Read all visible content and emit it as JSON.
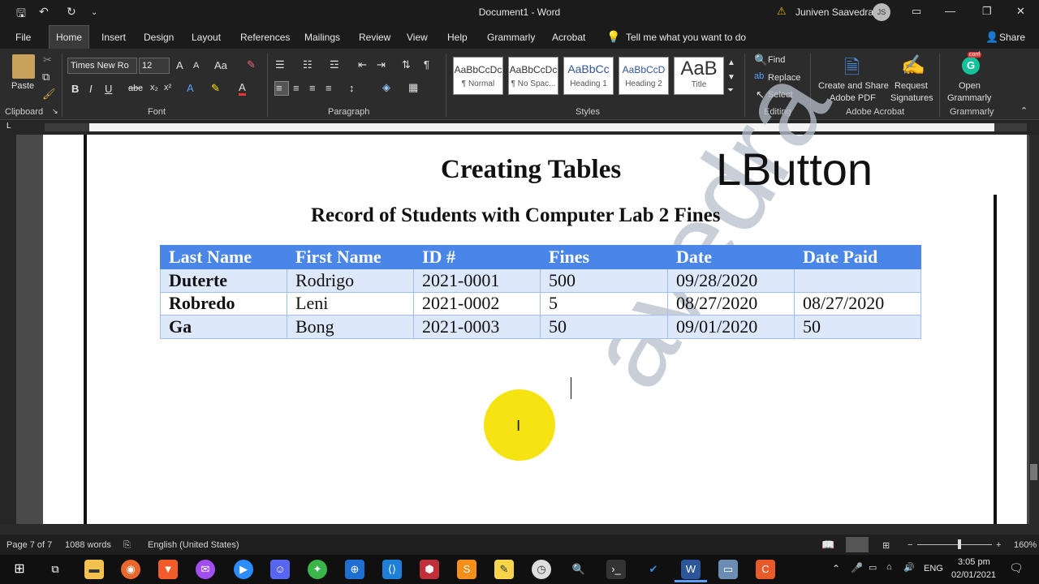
{
  "window": {
    "doc_title": "Document1 - Word",
    "user_name": "Juniven Saavedra",
    "user_initials": "JS"
  },
  "menu": {
    "items": [
      "File",
      "Home",
      "Insert",
      "Design",
      "Layout",
      "References",
      "Mailings",
      "Review",
      "View",
      "Help",
      "Grammarly",
      "Acrobat"
    ],
    "tell_me": "Tell me what you want to do",
    "share": "Share"
  },
  "ribbon": {
    "clipboard": {
      "paste": "Paste",
      "label": "Clipboard"
    },
    "font": {
      "name": "Times New Ro",
      "size": "12",
      "label": "Font"
    },
    "paragraph": {
      "label": "Paragraph"
    },
    "styles": {
      "label": "Styles",
      "items": [
        {
          "preview": "AaBbCcDc",
          "name": "¶ Normal"
        },
        {
          "preview": "AaBbCcDc",
          "name": "¶ No Spac..."
        },
        {
          "preview": "AaBbCc",
          "name": "Heading 1"
        },
        {
          "preview": "AaBbCcD",
          "name": "Heading 2"
        },
        {
          "preview": "AaB",
          "name": "Title"
        }
      ]
    },
    "editing": {
      "find": "Find",
      "replace": "Replace",
      "select": "Select",
      "label": "Editing"
    },
    "acrobat": {
      "create": "Create and Share",
      "create2": "Adobe PDF",
      "request": "Request",
      "request2": "Signatures",
      "label": "Adobe Acrobat"
    },
    "grammarly": {
      "open": "Open",
      "open2": "Grammarly",
      "label": "Grammarly",
      "badge": "conf"
    }
  },
  "document": {
    "title": "Creating Tables",
    "overlay": "LButton",
    "subtitle": "Record of Students with Computer Lab 2 Fines",
    "table": {
      "headers": [
        "Last Name",
        "First Name",
        "ID #",
        "Fines",
        "Date",
        "Date Paid"
      ],
      "rows": [
        [
          "Duterte",
          "Rodrigo",
          "2021-0001",
          "500",
          "09/28/2020",
          ""
        ],
        [
          "Robredo",
          "Leni",
          "2021-0002",
          "5",
          "08/27/2020",
          "08/27/2020"
        ],
        [
          "Ga",
          "Bong",
          "2021-0003",
          "50",
          "09/01/2020",
          "50"
        ]
      ]
    },
    "watermark": "avedra"
  },
  "status": {
    "page": "Page 7 of 7",
    "words": "1088 words",
    "language": "English (United States)",
    "zoom": "160%"
  },
  "taskbar": {
    "lang": "ENG",
    "time": "3:05 pm",
    "date": "02/01/2021"
  }
}
